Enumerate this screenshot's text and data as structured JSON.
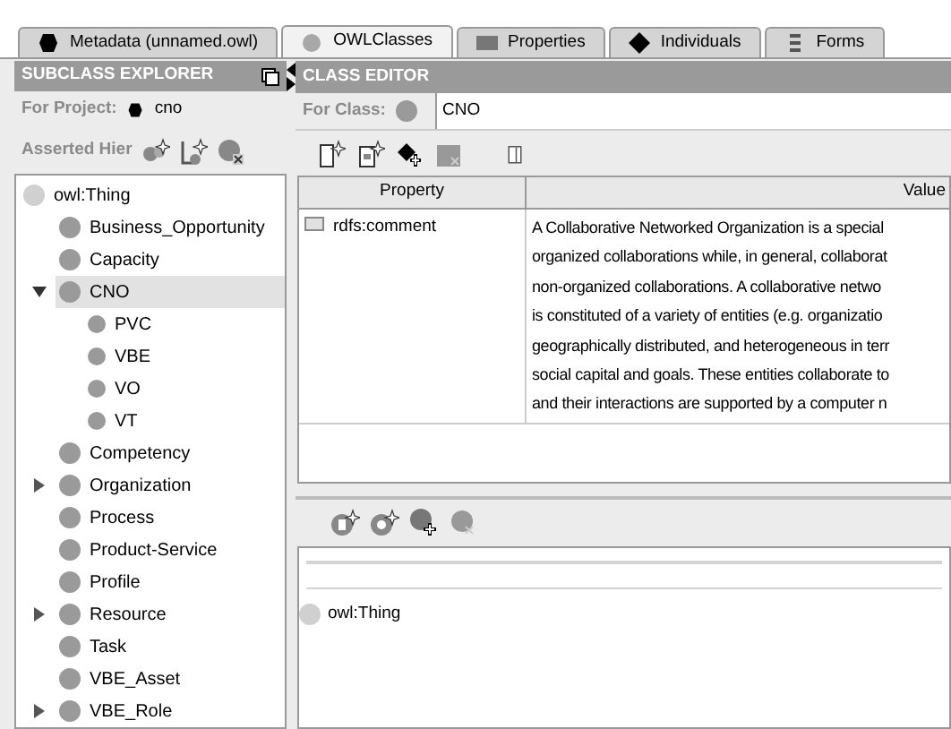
{
  "tabs": [
    {
      "label": "Metadata (unnamed.owl)",
      "kind": "metadata",
      "selected": false
    },
    {
      "label": "OWLClasses",
      "kind": "classes",
      "selected": true
    },
    {
      "label": "Properties",
      "kind": "properties",
      "selected": false
    },
    {
      "label": "Individuals",
      "kind": "individuals",
      "selected": false
    },
    {
      "label": "Forms",
      "kind": "forms",
      "selected": false
    }
  ],
  "subclass_explorer": {
    "title": "SUBCLASS EXPLORER",
    "project_label": "For Project:",
    "project": "cno",
    "hierarchy_label": "Asserted Hier",
    "tree": [
      {
        "label": "owl:Thing",
        "kind": "root",
        "selected": false,
        "children": [
          {
            "label": "Business_Opportunity",
            "kind": "leaf",
            "selected": false
          },
          {
            "label": "Capacity",
            "kind": "leaf",
            "selected": false
          },
          {
            "label": "CNO",
            "kind": "folder",
            "expanded": true,
            "selected": true,
            "children": [
              {
                "label": "PVC",
                "kind": "leaf",
                "selected": false
              },
              {
                "label": "VBE",
                "kind": "leaf",
                "selected": false
              },
              {
                "label": "VO",
                "kind": "leaf",
                "selected": false
              },
              {
                "label": "VT",
                "kind": "leaf",
                "selected": false
              }
            ]
          },
          {
            "label": "Competency",
            "kind": "leaf",
            "selected": false
          },
          {
            "label": "Organization",
            "kind": "folder",
            "expanded": false,
            "selected": false
          },
          {
            "label": "Process",
            "kind": "leaf",
            "selected": false
          },
          {
            "label": "Product-Service",
            "kind": "leaf",
            "selected": false
          },
          {
            "label": "Profile",
            "kind": "leaf",
            "selected": false
          },
          {
            "label": "Resource",
            "kind": "folder",
            "expanded": false,
            "selected": false
          },
          {
            "label": "Task",
            "kind": "leaf",
            "selected": false
          },
          {
            "label": "VBE_Asset",
            "kind": "leaf",
            "selected": false
          },
          {
            "label": "VBE_Role",
            "kind": "folder",
            "expanded": false,
            "selected": false
          }
        ]
      }
    ]
  },
  "class_editor": {
    "title": "CLASS EDITOR",
    "class_label": "For Class:",
    "class_value": "CNO",
    "table": {
      "columns": [
        "Property",
        "Value"
      ],
      "rows": [
        {
          "property": "rdfs:comment",
          "value_lines": [
            "A Collaborative Networked Organization is a special",
            "organized collaborations while, in general, collaborat",
            "non-organized collaborations. A collaborative netwo",
            "is constituted of a variety of entities (e.g. organizatio",
            "geographically distributed, and heterogeneous in terr",
            "social capital and goals. These entities collaborate to",
            "and their interactions are supported by a computer n"
          ]
        }
      ]
    },
    "superclasses": [
      "owl:Thing"
    ]
  }
}
